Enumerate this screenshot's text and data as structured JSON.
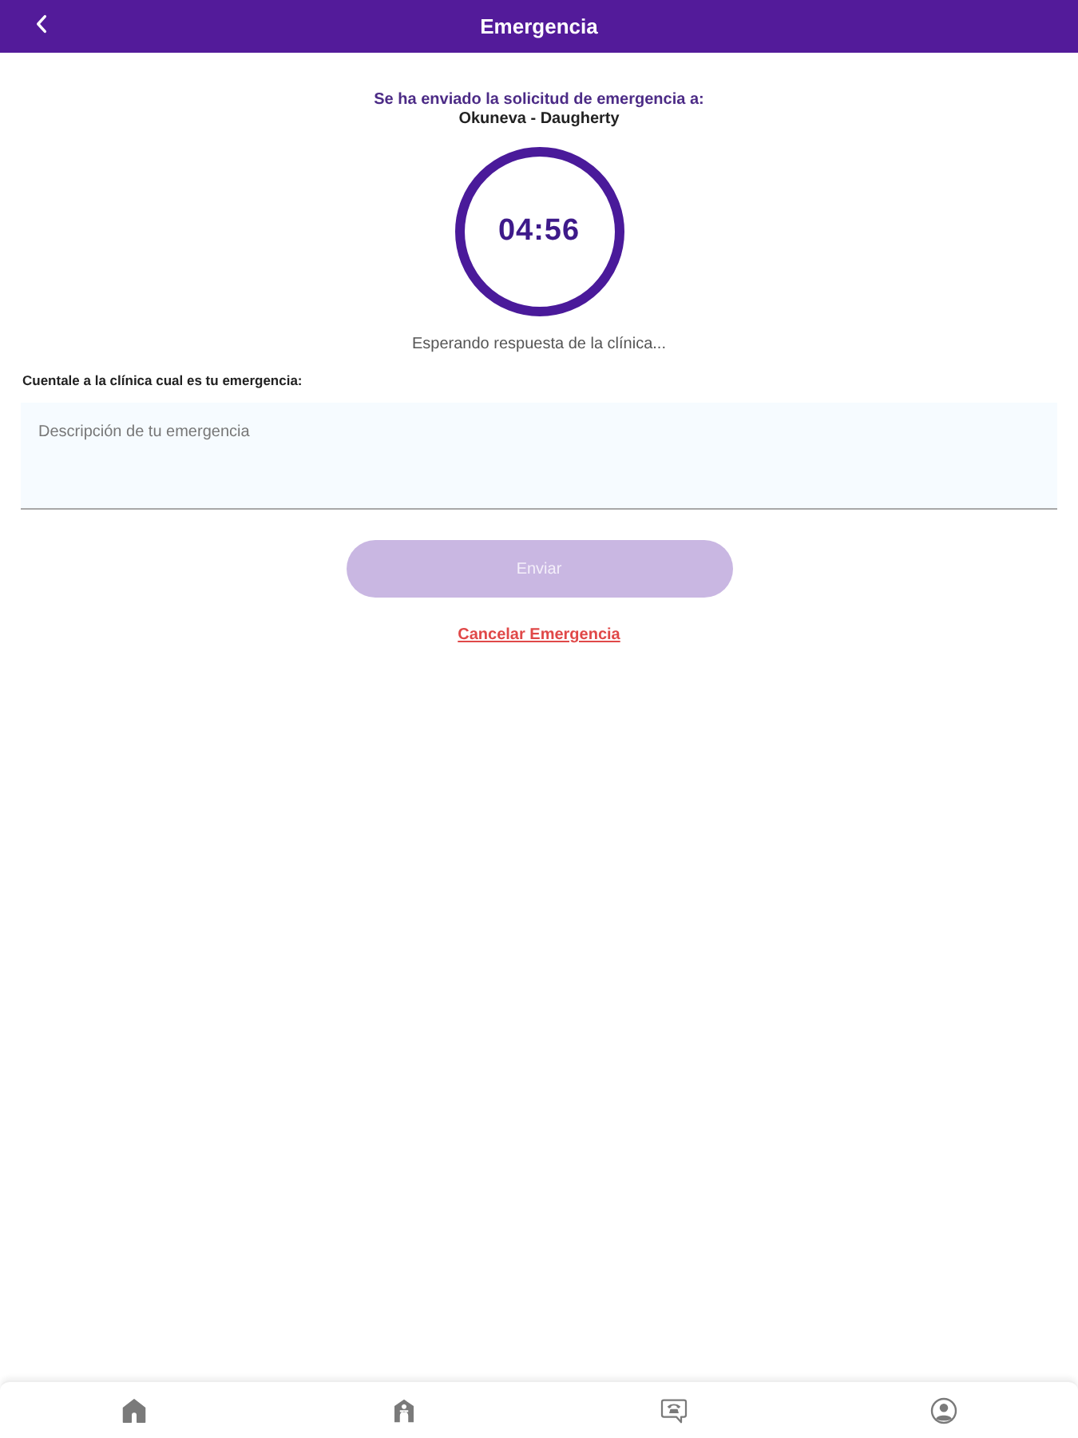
{
  "header": {
    "title": "Emergencia"
  },
  "request": {
    "heading": "Se ha enviado la solicitud de emergencia a:",
    "clinic": "Okuneva - Daugherty"
  },
  "timer": {
    "time": "04:56"
  },
  "status": "Esperando respuesta de la clínica...",
  "form": {
    "label": "Cuentale a la clínica cual es tu emergencia:",
    "placeholder": "Descripción de tu emergencia"
  },
  "send_button": {
    "label": "Enviar",
    "disabled": true
  },
  "cancel_link": "Cancelar Emergencia",
  "bottom_nav": [
    {
      "kind": "home",
      "selected": false
    },
    {
      "kind": "clinic",
      "selected": false
    },
    {
      "kind": "chat",
      "selected": false
    },
    {
      "kind": "profile",
      "selected": false
    }
  ]
}
